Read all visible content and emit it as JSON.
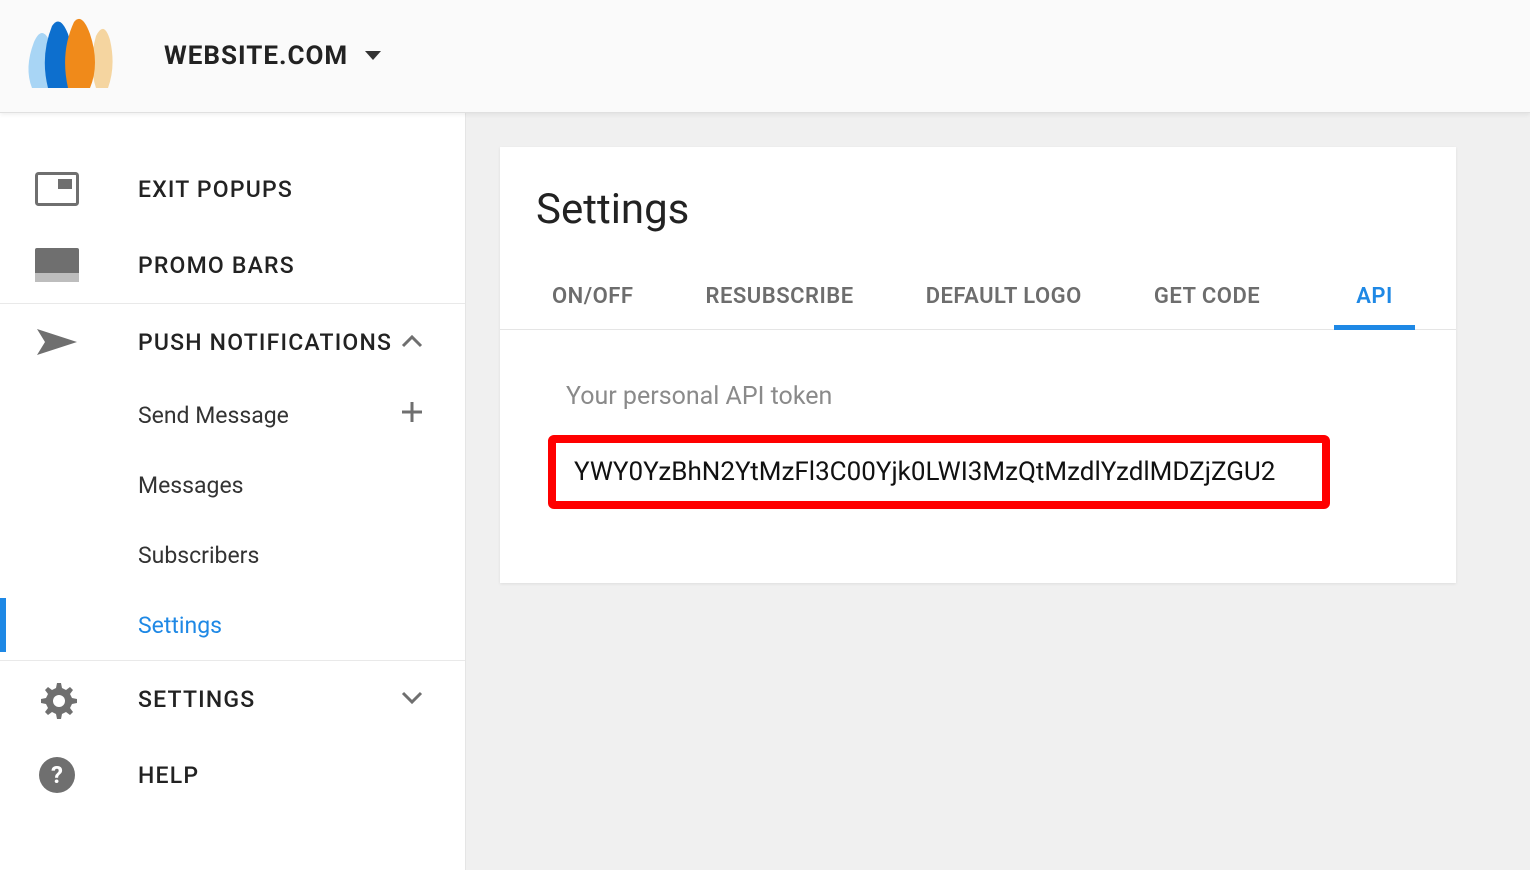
{
  "header": {
    "site_label": "WEBSITE.COM"
  },
  "sidebar": {
    "exit_popups": "EXIT POPUPS",
    "promo_bars": "PROMO BARS",
    "push_notifications": "PUSH NOTIFICATIONS",
    "sub": {
      "send_message": "Send Message",
      "messages": "Messages",
      "subscribers": "Subscribers",
      "settings": "Settings"
    },
    "settings": "SETTINGS",
    "help": "HELP"
  },
  "page": {
    "title": "Settings",
    "tabs": {
      "on_off": "ON/OFF",
      "resubscribe": "RESUBSCRIBE",
      "default_logo": "DEFAULT LOGO",
      "get_code": "GET CODE",
      "api": "API"
    },
    "api": {
      "token_label": "Your personal API token",
      "token_value": "YWY0YzBhN2YtMzFl3C00Yjk0LWI3MzQtMzdlYzdlMDZjZGU2"
    }
  }
}
